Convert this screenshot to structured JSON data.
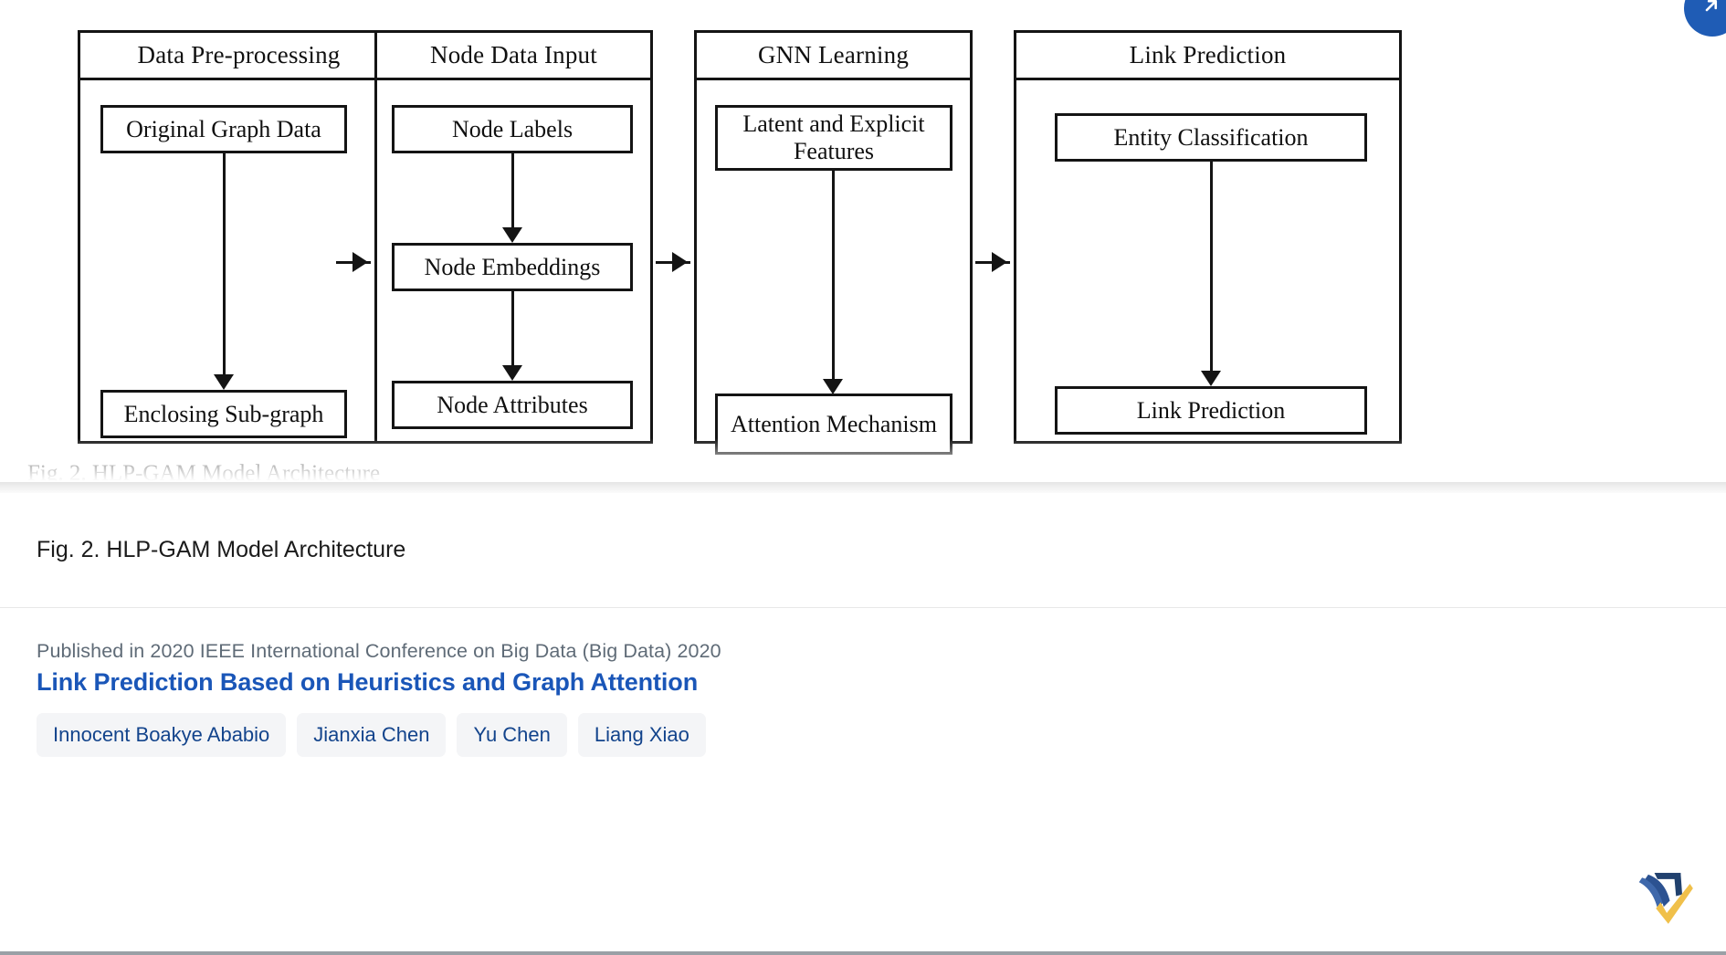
{
  "figure": {
    "caption_in_scan": "Fig. 2.  HLP-GAM Model Architecture",
    "columns": [
      {
        "header": "Data Pre-processing",
        "nodes": [
          "Original Graph Data",
          "Enclosing Sub-graph"
        ]
      },
      {
        "header": "Node Data Input",
        "nodes": [
          "Node Labels",
          "Node Embeddings",
          "Node Attributes"
        ]
      },
      {
        "header": "GNN Learning",
        "nodes": [
          "Latent and Explicit Features",
          "Attention Mechanism"
        ]
      },
      {
        "header": "Link Prediction",
        "nodes": [
          "Entity Classification",
          "Link Prediction"
        ]
      }
    ]
  },
  "viewer": {
    "expand_icon": "expand-arrow-icon"
  },
  "caption_panel": {
    "caption": "Fig. 2. HLP-GAM Model Architecture"
  },
  "paper": {
    "published": "Published in 2020 IEEE International Conference on Big Data (Big Data) 2020",
    "title": "Link Prediction Based on Heuristics and Graph Attention",
    "authors": [
      "Innocent Boakye Ababio",
      "Jianxia Chen",
      "Yu Chen",
      "Liang Xiao"
    ],
    "logo": "semantic-scholar-logo"
  },
  "colors": {
    "title_blue": "#1a56b8",
    "chip_bg": "#f4f5f7",
    "chip_text": "#13448c",
    "published_gray": "#5f6b77",
    "badge_blue": "#1f5cb5",
    "logo_navy": "#21416e",
    "logo_gold": "#f0c04a",
    "diagram_stroke": "#141414"
  }
}
